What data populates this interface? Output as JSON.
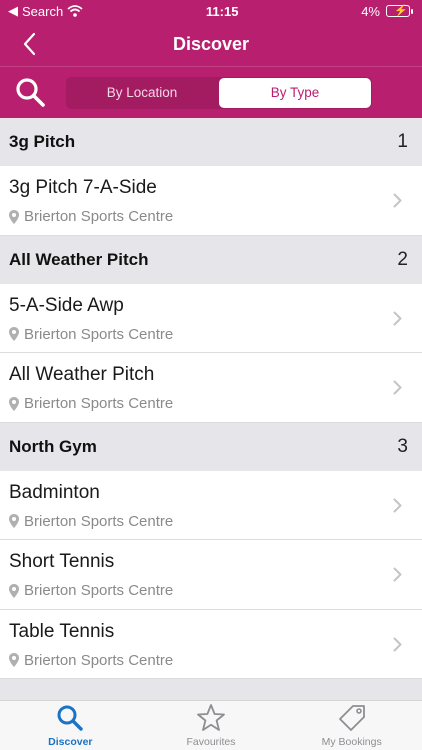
{
  "status_bar": {
    "back_app": "Search",
    "time": "11:15",
    "battery": "4%"
  },
  "nav": {
    "title": "Discover"
  },
  "segments": {
    "by_location": "By Location",
    "by_type": "By Type",
    "selected": "By Type"
  },
  "sections": [
    {
      "name": "3g Pitch",
      "count": "1",
      "items": [
        {
          "title": "3g Pitch 7-A-Side",
          "location": "Brierton Sports Centre"
        }
      ]
    },
    {
      "name": "All Weather Pitch",
      "count": "2",
      "items": [
        {
          "title": "5-A-Side Awp",
          "location": "Brierton Sports Centre"
        },
        {
          "title": "All Weather Pitch",
          "location": "Brierton Sports Centre"
        }
      ]
    },
    {
      "name": "North Gym",
      "count": "3",
      "items": [
        {
          "title": "Badminton",
          "location": "Brierton Sports Centre"
        },
        {
          "title": "Short Tennis",
          "location": "Brierton Sports Centre"
        },
        {
          "title": "Table Tennis",
          "location": "Brierton Sports Centre"
        }
      ]
    }
  ],
  "tabbar": {
    "discover": "Discover",
    "favourites": "Favourites",
    "bookings": "My Bookings",
    "active": "Discover"
  },
  "colors": {
    "brand": "#b8206f",
    "tab_active": "#1a73c7",
    "section_bg": "#e5e5ea"
  },
  "icons": {
    "back": "chevron-left-icon",
    "search": "search-icon",
    "pin": "location-pin-icon",
    "chevron": "chevron-right-icon",
    "favourites": "star-icon",
    "bookings": "tag-icon"
  }
}
